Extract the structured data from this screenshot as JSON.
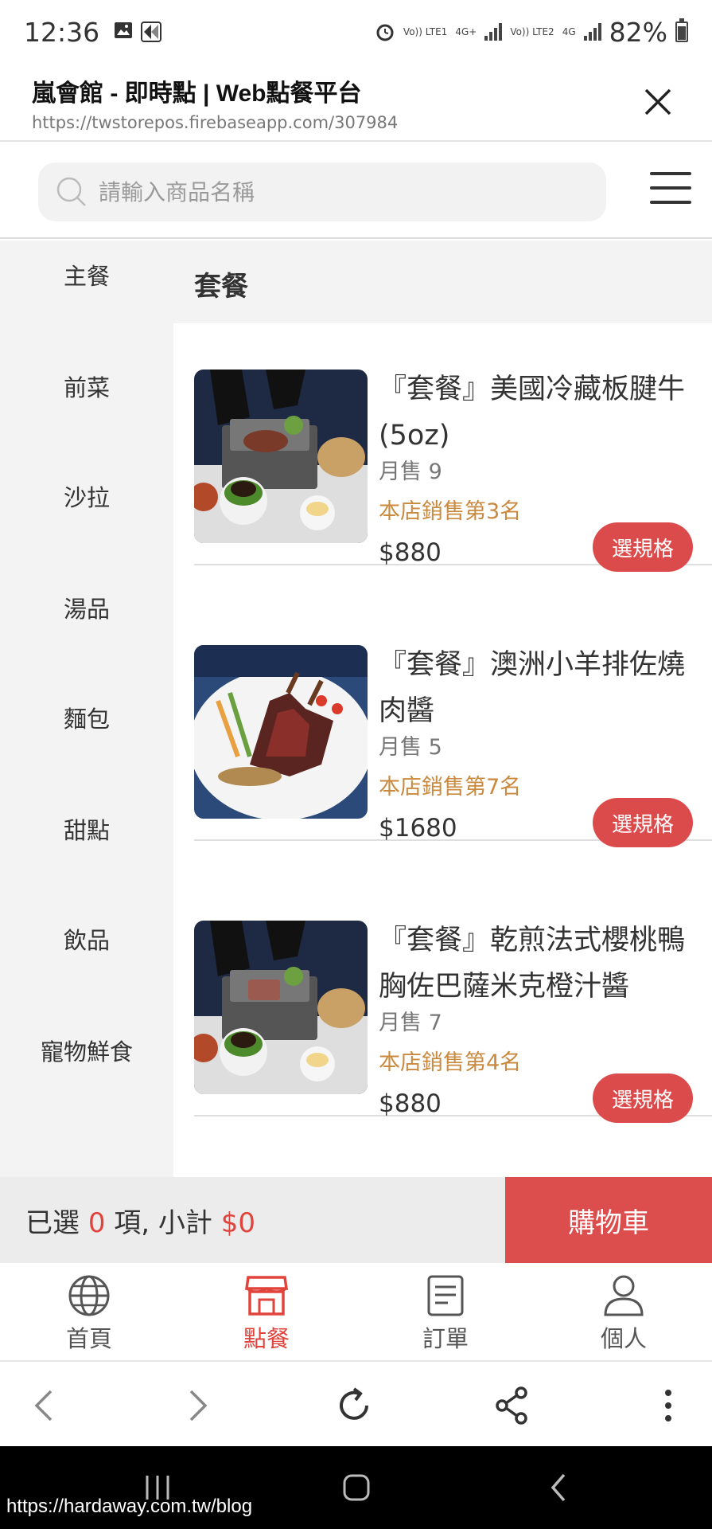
{
  "status_bar": {
    "time": "12:36",
    "sim1_label": "Vo)) LTE1",
    "net1_label": "4G+",
    "sim2_label": "Vo)) LTE2",
    "net2_label": "4G",
    "battery": "82%"
  },
  "browser": {
    "page_title": "嵐會館 - 即時點 | Web點餐平台",
    "url": "https://twstorepos.firebaseapp.com/307984"
  },
  "search": {
    "placeholder": "請輸入商品名稱"
  },
  "categories": [
    "主餐",
    "前菜",
    "沙拉",
    "湯品",
    "麵包",
    "甜點",
    "飲品",
    "寵物鮮食"
  ],
  "section_title": "套餐",
  "products": [
    {
      "name": "『套餐』美國冷藏板腱牛(5oz)",
      "sold": "月售 9",
      "rank": "本店銷售第3名",
      "price": "$880",
      "button": "選規格"
    },
    {
      "name": "『套餐』澳洲小羊排佐燒肉醬",
      "sold": "月售 5",
      "rank": "本店銷售第7名",
      "price": "$1680",
      "button": "選規格"
    },
    {
      "name": "『套餐』乾煎法式櫻桃鴨胸佐巴薩米克橙汁醬",
      "sold": "月售 7",
      "rank": "本店銷售第4名",
      "price": "$880",
      "button": "選規格"
    }
  ],
  "cart": {
    "prefix": "已選",
    "count": "0",
    "middle": "項, 小計",
    "subtotal": "$0",
    "button": "購物車"
  },
  "tabs": [
    {
      "label": "首頁",
      "icon": "globe-icon"
    },
    {
      "label": "點餐",
      "icon": "store-icon"
    },
    {
      "label": "訂單",
      "icon": "order-icon"
    },
    {
      "label": "個人",
      "icon": "person-icon"
    }
  ],
  "watermark": "https://hardaway.com.tw/blog",
  "colors": {
    "accent": "#dc4b4b",
    "rank": "#c9893e",
    "sidebar_bg": "#f3f3f3"
  }
}
